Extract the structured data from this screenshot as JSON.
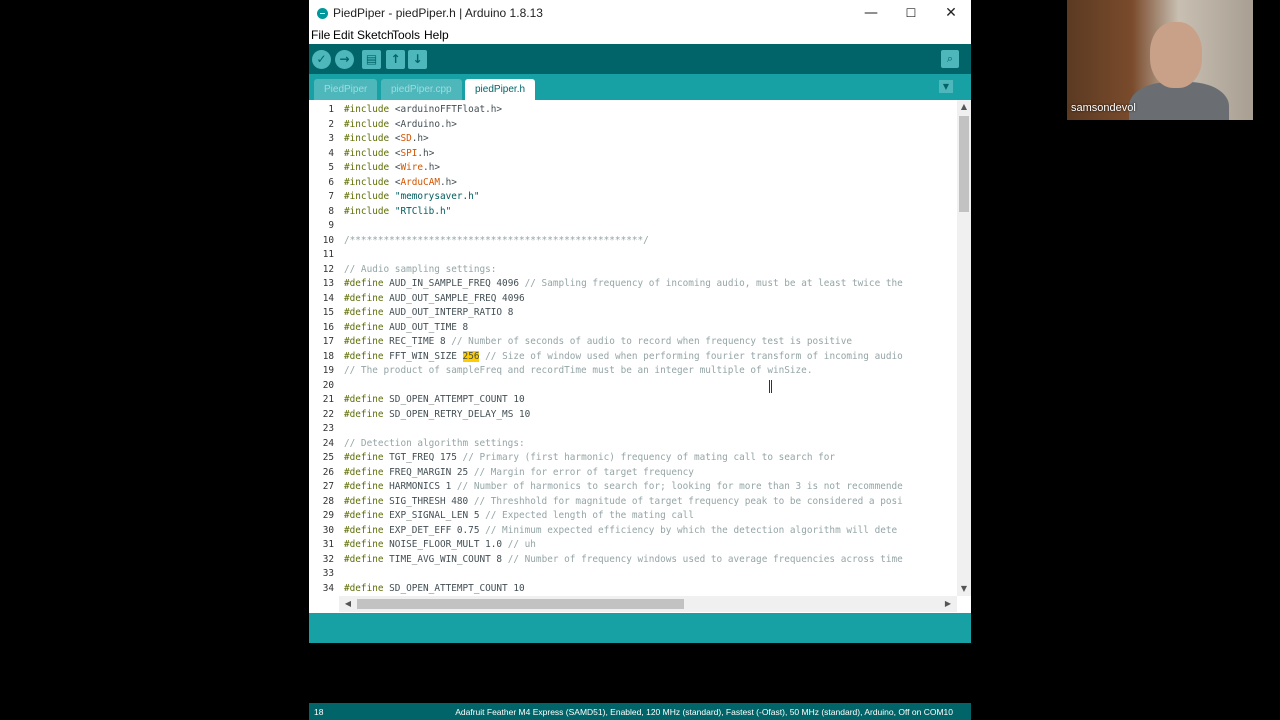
{
  "window": {
    "title": "PiedPiper - piedPiper.h | Arduino 1.8.13",
    "controls": [
      "—",
      "☐",
      "✕"
    ]
  },
  "menu": [
    "File",
    "Edit",
    "Sketch",
    "Tools",
    "Help"
  ],
  "toolbar": {
    "verify": "✓",
    "upload": "→",
    "new": "▤",
    "open": "↑",
    "save": "↓",
    "serial_monitor": "⌕"
  },
  "tabs": [
    {
      "label": "PiedPiper",
      "active": false
    },
    {
      "label": "piedPiper.cpp",
      "active": false
    },
    {
      "label": "piedPiper.h",
      "active": true
    }
  ],
  "tab_menu": "▼",
  "code_lines": [
    {
      "n": "1",
      "parts": [
        [
          "kw",
          "#include"
        ],
        [
          "",
          "<arduinoFFTFloat.h>"
        ]
      ]
    },
    {
      "n": "2",
      "parts": [
        [
          "kw",
          "#include"
        ],
        [
          "",
          "<Arduino.h>"
        ]
      ]
    },
    {
      "n": "3",
      "parts": [
        [
          "kw",
          "#include"
        ],
        [
          "",
          "<"
        ],
        [
          "dir",
          "SD"
        ],
        [
          "",
          ".h>"
        ]
      ]
    },
    {
      "n": "4",
      "parts": [
        [
          "kw",
          "#include"
        ],
        [
          "",
          "<"
        ],
        [
          "dir",
          "SPI"
        ],
        [
          "",
          ".h>"
        ]
      ]
    },
    {
      "n": "5",
      "parts": [
        [
          "kw",
          "#include"
        ],
        [
          "",
          "<"
        ],
        [
          "dir",
          "Wire"
        ],
        [
          "",
          ".h>"
        ]
      ]
    },
    {
      "n": "6",
      "parts": [
        [
          "kw",
          "#include"
        ],
        [
          "",
          "<"
        ],
        [
          "dir",
          "ArduCAM"
        ],
        [
          "",
          ".h>"
        ]
      ]
    },
    {
      "n": "7",
      "parts": [
        [
          "kw",
          "#include"
        ],
        [
          "str",
          "\"memorysaver.h\""
        ]
      ]
    },
    {
      "n": "8",
      "parts": [
        [
          "kw",
          "#include"
        ],
        [
          "str",
          "\"RTClib.h\""
        ]
      ]
    },
    {
      "n": "9",
      "parts": []
    },
    {
      "n": "10",
      "parts": [
        [
          "com",
          "/****************************************************/"
        ]
      ]
    },
    {
      "n": "11",
      "parts": []
    },
    {
      "n": "12",
      "parts": [
        [
          "com",
          "// Audio sampling settings:"
        ]
      ]
    },
    {
      "n": "13",
      "parts": [
        [
          "kw",
          "#define"
        ],
        [
          "",
          " AUD_IN_SAMPLE_FREQ 4096 "
        ],
        [
          "com",
          "// Sampling frequency of incoming audio, must be at least twice the"
        ]
      ]
    },
    {
      "n": "14",
      "parts": [
        [
          "kw",
          "#define"
        ],
        [
          "",
          " AUD_OUT_SAMPLE_FREQ 4096"
        ]
      ]
    },
    {
      "n": "15",
      "parts": [
        [
          "kw",
          "#define"
        ],
        [
          "",
          " AUD_OUT_INTERP_RATIO 8"
        ]
      ]
    },
    {
      "n": "16",
      "parts": [
        [
          "kw",
          "#define"
        ],
        [
          "",
          " AUD_OUT_TIME 8"
        ]
      ]
    },
    {
      "n": "17",
      "parts": [
        [
          "kw",
          "#define"
        ],
        [
          "",
          " REC_TIME 8 "
        ],
        [
          "com",
          "// Number of seconds of audio to record when frequency test is positive"
        ]
      ]
    },
    {
      "n": "18",
      "parts": [
        [
          "kw",
          "#define"
        ],
        [
          "",
          " FFT_WIN_SIZE "
        ],
        [
          "hl",
          "256"
        ],
        [
          "",
          " "
        ],
        [
          "com",
          "// Size of window used when performing fourier transform of incoming audio"
        ]
      ]
    },
    {
      "n": "19",
      "parts": [
        [
          "com",
          "// The product of sampleFreq and recordTime must be an integer multiple of winSize."
        ]
      ]
    },
    {
      "n": "20",
      "parts": []
    },
    {
      "n": "21",
      "parts": [
        [
          "kw",
          "#define"
        ],
        [
          "",
          " SD_OPEN_ATTEMPT_COUNT 10"
        ]
      ]
    },
    {
      "n": "22",
      "parts": [
        [
          "kw",
          "#define"
        ],
        [
          "",
          " SD_OPEN_RETRY_DELAY_MS 10"
        ]
      ]
    },
    {
      "n": "23",
      "parts": []
    },
    {
      "n": "24",
      "parts": [
        [
          "com",
          "// Detection algorithm settings:"
        ]
      ]
    },
    {
      "n": "25",
      "parts": [
        [
          "kw",
          "#define"
        ],
        [
          "",
          " TGT_FREQ 175 "
        ],
        [
          "com",
          "// Primary (first harmonic) frequency of mating call to search for"
        ]
      ]
    },
    {
      "n": "26",
      "parts": [
        [
          "kw",
          "#define"
        ],
        [
          "",
          " FREQ_MARGIN 25 "
        ],
        [
          "com",
          "// Margin for error of target frequency"
        ]
      ]
    },
    {
      "n": "27",
      "parts": [
        [
          "kw",
          "#define"
        ],
        [
          "",
          " HARMONICS 1 "
        ],
        [
          "com",
          "// Number of harmonics to search for; looking for more than 3 is not recommende"
        ]
      ]
    },
    {
      "n": "28",
      "parts": [
        [
          "kw",
          "#define"
        ],
        [
          "",
          " SIG_THRESH 480 "
        ],
        [
          "com",
          "// Threshhold for magnitude of target frequency peak to be considered a posi"
        ]
      ]
    },
    {
      "n": "29",
      "parts": [
        [
          "kw",
          "#define"
        ],
        [
          "",
          " EXP_SIGNAL_LEN 5 "
        ],
        [
          "com",
          "// Expected length of the mating call"
        ]
      ]
    },
    {
      "n": "30",
      "parts": [
        [
          "kw",
          "#define"
        ],
        [
          "",
          " EXP_DET_EFF 0.75 "
        ],
        [
          "com",
          "// Minimum expected efficiency by which the detection algorithm will dete"
        ]
      ]
    },
    {
      "n": "31",
      "parts": [
        [
          "kw",
          "#define"
        ],
        [
          "",
          " NOISE_FLOOR_MULT 1.0 "
        ],
        [
          "com",
          "// uh"
        ]
      ]
    },
    {
      "n": "32",
      "parts": [
        [
          "kw",
          "#define"
        ],
        [
          "",
          " TIME_AVG_WIN_COUNT 8 "
        ],
        [
          "com",
          "// Number of frequency windows used to average frequencies across time"
        ]
      ]
    },
    {
      "n": "33",
      "parts": []
    },
    {
      "n": "34",
      "parts": [
        [
          "kw",
          "#define"
        ],
        [
          "",
          " SD_OPEN_ATTEMPT_COUNT 10"
        ]
      ]
    }
  ],
  "statusbar": {
    "line": "18",
    "board": "Adafruit Feather M4 Express (SAMD51), Enabled, 120 MHz (standard), Fastest (-Ofast), 50 MHz (standard), Arduino, Off on COM10"
  },
  "webcam": {
    "name": "samsondevol"
  }
}
